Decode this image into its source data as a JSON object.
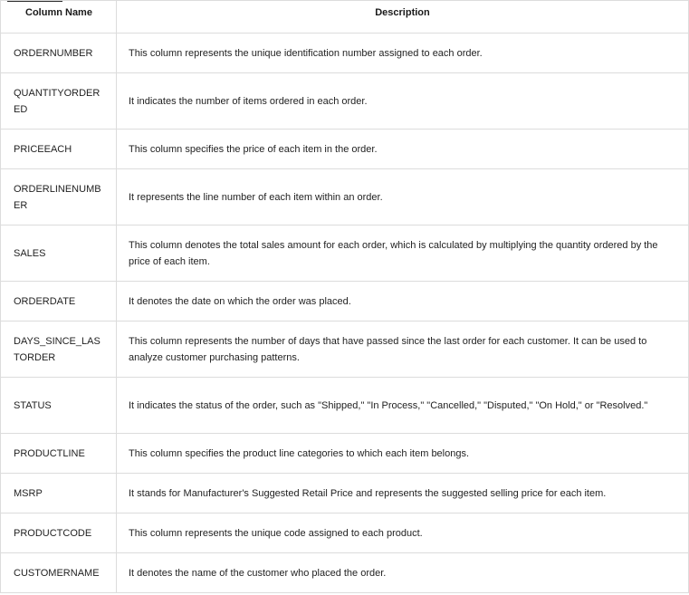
{
  "table": {
    "headers": {
      "name": "Column Name",
      "description": "Description"
    },
    "rows": [
      {
        "name": "ORDERNUMBER",
        "description": "This column represents the unique identification number assigned to each order."
      },
      {
        "name": "QUANTITYORDERED",
        "description": "It indicates the number of items ordered in each order."
      },
      {
        "name": "PRICEEACH",
        "description": "This column specifies the price of each item in the order."
      },
      {
        "name": "ORDERLINENUMBER",
        "description": "It represents the line number of each item within an order."
      },
      {
        "name": "SALES",
        "description": "This column denotes the total sales amount for each order, which is calculated by multiplying the quantity ordered by the price of each item."
      },
      {
        "name": "ORDERDATE",
        "description": "It denotes the date on which the order was placed."
      },
      {
        "name": "DAYS_SINCE_LASTORDER",
        "description": "This column represents the number of days that have passed since the last order for each customer. It can be used to analyze customer purchasing patterns."
      },
      {
        "name": "STATUS",
        "description": "It indicates the status of the order, such as \"Shipped,\" \"In Process,\" \"Cancelled,\" \"Disputed,\" \"On Hold,\" or \"Resolved.\""
      },
      {
        "name": "PRODUCTLINE",
        "description": "This column specifies the product line categories to which each item belongs."
      },
      {
        "name": "MSRP",
        "description": "It stands for Manufacturer's Suggested Retail Price and represents the suggested selling price for each item."
      },
      {
        "name": "PRODUCTCODE",
        "description": "This column represents the unique code assigned to each product."
      },
      {
        "name": "CUSTOMERNAME",
        "description": "It denotes the name of the customer who placed the order."
      }
    ]
  }
}
